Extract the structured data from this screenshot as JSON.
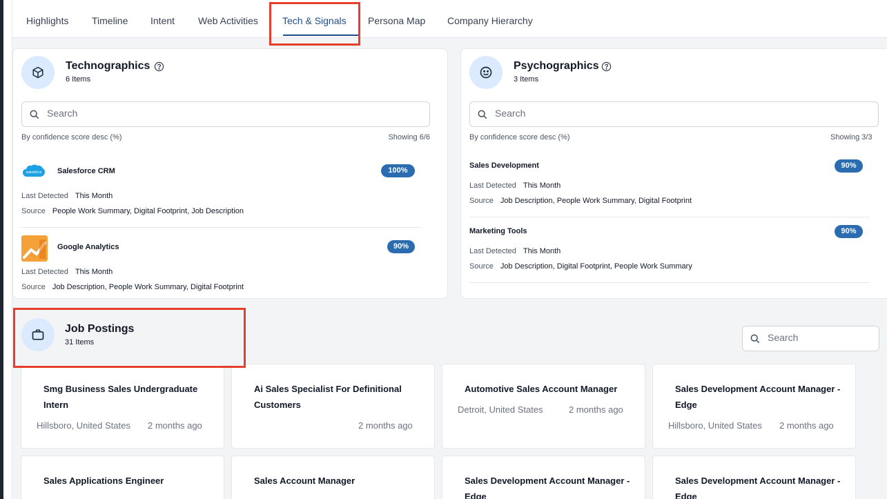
{
  "tabs": [
    "Highlights",
    "Timeline",
    "Intent",
    "Web Activities",
    "Tech & Signals",
    "Persona Map",
    "Company Hierarchy"
  ],
  "active_tab": "Tech & Signals",
  "technographics": {
    "title": "Technographics",
    "count": "6 Items",
    "search_placeholder": "Search",
    "sort_label": "By confidence score desc (%)",
    "showing": "Showing 6/6",
    "items": [
      {
        "name": "Salesforce CRM",
        "score": "100%",
        "last_detected_label": "Last Detected",
        "last_detected": "This Month",
        "source_label": "Source",
        "source": "People Work Summary, Digital Footprint, Job Description",
        "logo_text": "salesforce"
      },
      {
        "name": "Google Analytics",
        "score": "90%",
        "last_detected_label": "Last Detected",
        "last_detected": "This Month",
        "source_label": "Source",
        "source": "Job Description, People Work Summary, Digital Footprint"
      }
    ]
  },
  "psychographics": {
    "title": "Psychographics",
    "count": "3 Items",
    "search_placeholder": "Search",
    "sort_label": "By confidence score desc (%)",
    "showing": "Showing 3/3",
    "items": [
      {
        "name": "Sales Development",
        "score": "90%",
        "last_detected_label": "Last Detected",
        "last_detected": "This Month",
        "source_label": "Source",
        "source": "Job Description, People Work Summary, Digital Footprint"
      },
      {
        "name": "Marketing Tools",
        "score": "90%",
        "last_detected_label": "Last Detected",
        "last_detected": "This Month",
        "source_label": "Source",
        "source": "Job Description, Digital Footprint, People Work Summary"
      }
    ]
  },
  "jobs": {
    "title": "Job Postings",
    "count": "31 Items",
    "search_placeholder": "Search",
    "cards": [
      {
        "title": "Smg Business Sales Undergraduate Intern",
        "location": "Hillsboro, United States",
        "age": "2 months ago"
      },
      {
        "title": "Ai Sales Specialist For Definitional Customers",
        "location": "",
        "age": "2 months ago"
      },
      {
        "title": "Automotive Sales Account Manager",
        "location": "Detroit, United States",
        "age": "2 months ago"
      },
      {
        "title": "Sales Development Account Manager - Edge",
        "location": "Hillsboro, United States",
        "age": "2 months ago"
      },
      {
        "title": "Sales Applications Engineer",
        "location": "",
        "age": ""
      },
      {
        "title": "Sales Account Manager",
        "location": "",
        "age": ""
      },
      {
        "title": "Sales Development Account Manager - Edge",
        "location": "",
        "age": ""
      },
      {
        "title": "Sales Development Account Manager - Edge",
        "location": "",
        "age": ""
      }
    ]
  },
  "colors": {
    "accent": "#1f4e8c",
    "badge": "#2b6cb0",
    "highlight": "#e53e2d",
    "icon_bg": "#dbeafe"
  }
}
